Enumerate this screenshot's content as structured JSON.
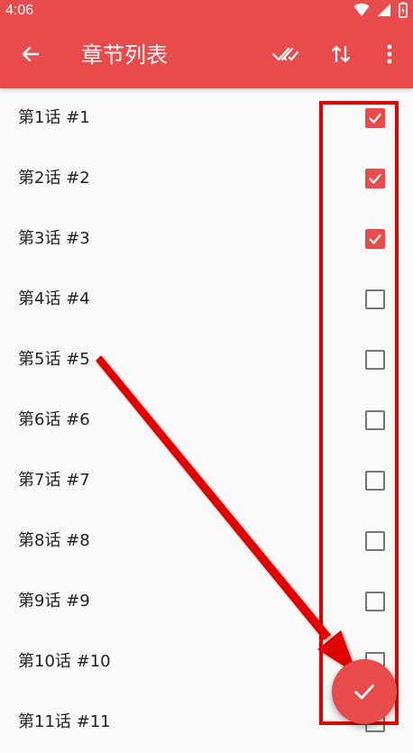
{
  "status_bar": {
    "time": "4:06"
  },
  "app_bar": {
    "title": "章节列表",
    "back_icon": "arrow-left-icon",
    "select_all_icon": "double-check-icon",
    "sort_icon": "sort-icon",
    "overflow_icon": "more-vert-icon"
  },
  "chapters": [
    {
      "label": "第1话 #1",
      "checked": true
    },
    {
      "label": "第2话 #2",
      "checked": true
    },
    {
      "label": "第3话 #3",
      "checked": true
    },
    {
      "label": "第4话 #4",
      "checked": false
    },
    {
      "label": "第5话 #5",
      "checked": false
    },
    {
      "label": "第6话 #6",
      "checked": false
    },
    {
      "label": "第7话 #7",
      "checked": false
    },
    {
      "label": "第8话 #8",
      "checked": false
    },
    {
      "label": "第9话 #9",
      "checked": false
    },
    {
      "label": "第10话 #10",
      "checked": false
    },
    {
      "label": "第11话 #11",
      "checked": false
    }
  ],
  "fab": {
    "icon": "check-icon"
  },
  "colors": {
    "accent": "#e84b4b",
    "annotation": "#e00000",
    "checkbox_off": "#757575"
  }
}
